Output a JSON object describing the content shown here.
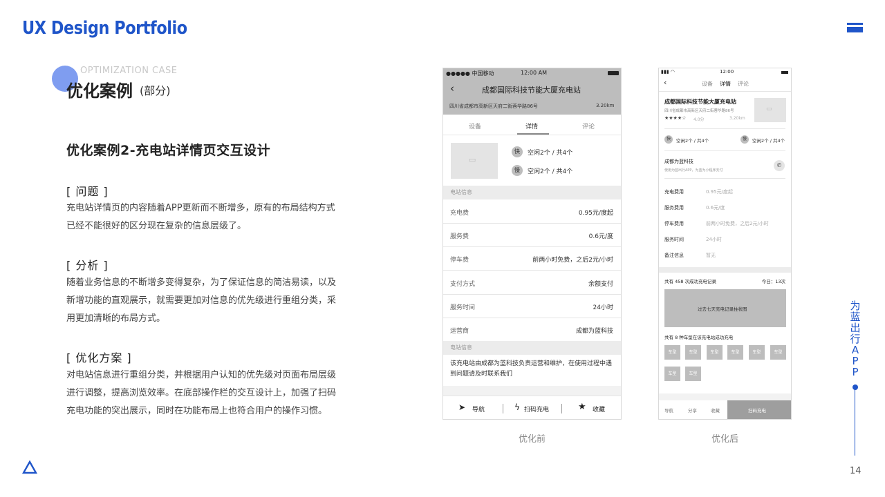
{
  "header": {
    "brand": "UX Design Portfolio",
    "menu_icon": "menu-icon"
  },
  "section": {
    "eyebrow": "OPTIMIZATION CASE",
    "title": "优化案例",
    "subtitle": "(部分)"
  },
  "case": {
    "title": "优化案例2-充电站详情页交互设计",
    "problem": {
      "heading": "[ 问题 ]",
      "text": "充电站详情页的内容随着APP更新而不断增多，原有的布局结构方式已经不能很好的区分现在复杂的信息层级了。"
    },
    "analysis": {
      "heading": "[ 分析 ]",
      "text": "随着业务信息的不断增多变得复杂，为了保证信息的简洁易读，以及新增功能的直观展示，就需要更加对信息的优先级进行重组分类，采用更加清晰的布局方式。"
    },
    "solution": {
      "heading": "[ 优化方案 ]",
      "text": "对电站信息进行重组分类，并根据用户认知的优先级对页面布局层级进行调整，提高浏览效率。在底部操作栏的交互设计上，加强了扫码充电功能的突出展示，同时在功能布局上也符合用户的操作习惯。"
    }
  },
  "before": {
    "caption": "优化前",
    "status": {
      "carrier": "●●●●● 中国移动",
      "time": "12:00 AM"
    },
    "nav_title": "成都国际科技节能大厦充电站",
    "address": "四川省成都市高新区天府二街蓉华路86号",
    "distance": "3.20km",
    "tabs": [
      "设备",
      "详情",
      "评论"
    ],
    "availability": [
      {
        "badge": "快",
        "text": "空闲2个 / 共4个"
      },
      {
        "badge": "慢",
        "text": "空闲2个 / 共4个"
      }
    ],
    "info_section": "电站信息",
    "rows": [
      {
        "label": "充电费",
        "value": "0.95元/度起"
      },
      {
        "label": "服务费",
        "value": "0.6元/度"
      },
      {
        "label": "停车费",
        "value": "前两小时免费，之后2元/小时"
      },
      {
        "label": "支付方式",
        "value": "余额支付"
      },
      {
        "label": "服务时间",
        "value": "24小时"
      },
      {
        "label": "运营商",
        "value": "成都为蓝科技"
      }
    ],
    "info_section_2": "电站信息",
    "note": "该充电站由成都为蓝科技负责运营和维护，在使用过程中遇到问题请及时联系我们",
    "bottom": {
      "nav": "导航",
      "scan": "扫码充电",
      "fav": "收藏"
    }
  },
  "after": {
    "caption": "优化后",
    "status_time": "12:00",
    "tabs": [
      "设备",
      "详情",
      "评论"
    ],
    "title": "成都国际科技节能大厦充电站",
    "address": "四川省成都市高新区天府二街蓉华路86号",
    "stars": "★★★★☆",
    "rating": "4.0分",
    "distance": "3.20km",
    "availability": [
      {
        "badge": "快",
        "text": "空闲2个 / 共4个"
      },
      {
        "badge": "慢",
        "text": "空闲2个 / 共4个"
      }
    ],
    "operator": {
      "name": "成都为蓝科技",
      "desc": "使用为蓝出行APP，为蓝为小程序支付"
    },
    "rows": [
      {
        "label": "充电费用",
        "value": "0.95元/度起"
      },
      {
        "label": "服务费用",
        "value": "0.6元/度"
      },
      {
        "label": "停车费用",
        "value": "前两小时免费，之后2元/小时"
      },
      {
        "label": "服务时间",
        "value": "24小时"
      },
      {
        "label": "备注信息",
        "value": "暂无"
      }
    ],
    "records": {
      "left": "共有 458 次成功充电记录",
      "right": "今日：13次"
    },
    "chart_placeholder": "过去七天充电记录柱状图",
    "cars_title": "共有 8 种车型在该充电站成功充电",
    "car_label": "车型",
    "bottom": {
      "nav": "导航",
      "share": "分享",
      "fav": "收藏",
      "scan": "扫码充电"
    }
  },
  "side": {
    "vertical_label": [
      "为",
      "蓝",
      "出",
      "行",
      "A",
      "P",
      "P"
    ],
    "page_number": "14"
  }
}
